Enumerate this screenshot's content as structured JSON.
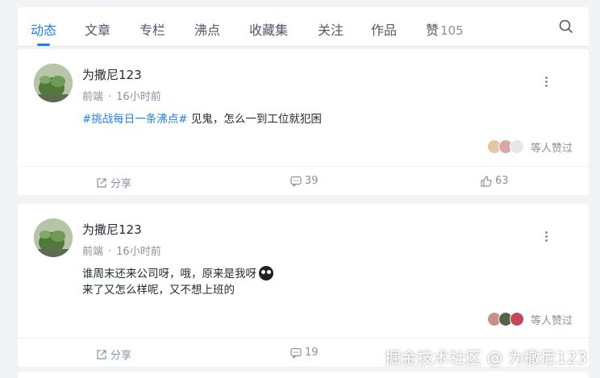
{
  "tabs": [
    {
      "label": "动态"
    },
    {
      "label": "文章"
    },
    {
      "label": "专栏"
    },
    {
      "label": "沸点"
    },
    {
      "label": "收藏集"
    },
    {
      "label": "关注"
    },
    {
      "label": "作品"
    },
    {
      "label": "赞",
      "count": "105"
    }
  ],
  "active_tab": "动态",
  "posts": [
    {
      "username": "为撒尼123",
      "category": "前端",
      "separator": "·",
      "time": "16小时前",
      "topic": "#挑战每日一条沸点#",
      "text_lines": [
        " 见鬼，怎么一到工位就犯困"
      ],
      "likers_text": "等人赞过",
      "share_label": "分享",
      "comments": "39",
      "likes": "63"
    },
    {
      "username": "为撒尼123",
      "category": "前端",
      "separator": "·",
      "time": "16小时前",
      "text_lines": [
        "谁周末还来公司呀，哦，原来是我呀",
        "来了又怎么样呢，又不想上班的"
      ],
      "likers_text": "等人赞过",
      "share_label": "分享",
      "comments": "19"
    }
  ],
  "watermark": "掘金技术社区 @ 为撒尼123",
  "colors": {
    "accent": "#1e80ff",
    "muted": "#8a919f",
    "background": "#f2f3f5"
  },
  "icons": [
    "search-icon",
    "more-icon",
    "share-icon",
    "comment-icon",
    "like-icon"
  ]
}
